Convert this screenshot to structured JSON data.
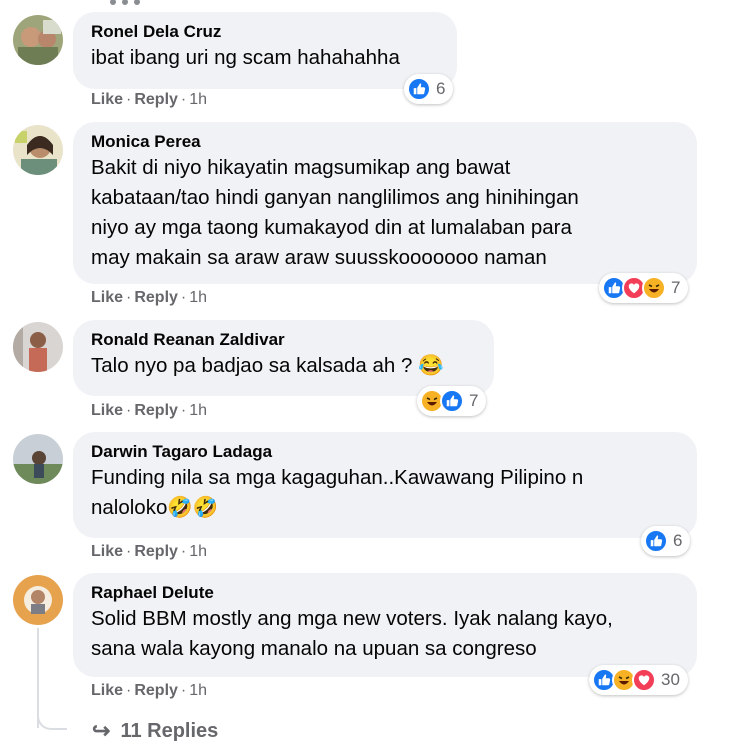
{
  "comments": [
    {
      "author": "Ronel Dela Cruz",
      "text": "ibat ibang uri ng scam hahahahha",
      "like": "Like",
      "reply": "Reply",
      "time": "1h",
      "reaction_count": "6",
      "reactions": [
        "like"
      ]
    },
    {
      "author": "Monica Perea",
      "text": "Bakit di niyo hikayatin magsumikap ang bawat\nkabataan/tao hindi ganyan nanglilimos ang hinihingan\nniyo ay mga taong kumakayod din at lumalaban para\nmay makain sa araw araw suusskooooooo naman",
      "like": "Like",
      "reply": "Reply",
      "time": "1h",
      "reaction_count": "7",
      "reactions": [
        "like",
        "love",
        "haha"
      ]
    },
    {
      "author": "Ronald Reanan Zaldivar",
      "text": "Talo nyo pa badjao sa kalsada ah ? 😂",
      "like": "Like",
      "reply": "Reply",
      "time": "1h",
      "reaction_count": "7",
      "reactions": [
        "haha",
        "like"
      ]
    },
    {
      "author": "Darwin Tagaro Ladaga",
      "text": "Funding nila sa mga kagaguhan..Kawawang Pilipino n\nnaloloko🤣🤣",
      "like": "Like",
      "reply": "Reply",
      "time": "1h",
      "reaction_count": "6",
      "reactions": [
        "like"
      ]
    },
    {
      "author": "Raphael Delute",
      "text": "Solid BBM mostly ang mga new voters. Iyak nalang kayo,\nsana wala kayong manalo na upuan sa congreso",
      "like": "Like",
      "reply": "Reply",
      "time": "1h",
      "reaction_count": "30",
      "reactions": [
        "like",
        "haha",
        "love"
      ]
    }
  ],
  "replies_link": {
    "arrow": "↪",
    "label": "11 Replies"
  },
  "colors": {
    "bubble": "#f0f2f5",
    "meta": "#65676b",
    "like_blue": "#1877f2",
    "love_red": "#f33e58",
    "haha_yellow": "#f7b125"
  }
}
